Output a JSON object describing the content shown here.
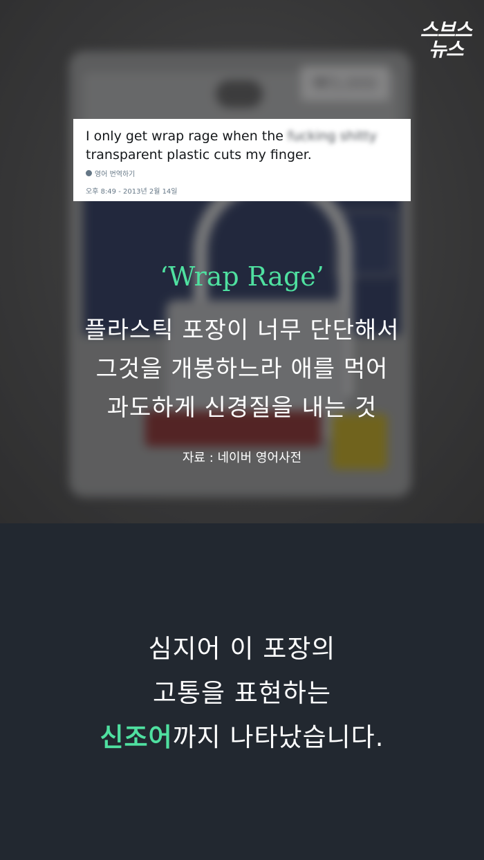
{
  "brand": {
    "logo_line1": "스브스",
    "logo_line2": "뉴스"
  },
  "photo": {
    "price_tag": "₩3,000"
  },
  "tweet": {
    "text_visible": "I only get wrap rage when the",
    "text_blurred": "fucking shitty",
    "text_line2": "transparent plastic cuts my finger.",
    "translate_label": "영어 번역하기",
    "timestamp": "오후 8:49 - 2013년 2월 14일"
  },
  "headline": "‘Wrap Rage’",
  "description": {
    "line1": "플라스틱 포장이 너무 단단해서",
    "line2": "그것을 개봉하느라 애를 먹어",
    "line3": "과도하게 신경질을 내는 것"
  },
  "source": "자료 : 네이버 영어사전",
  "message": {
    "line1": "심지어 이 포장의",
    "line2": "고통을 표현하는",
    "line3_highlight": "신조어",
    "line3_rest": "까지 나타났습니다."
  },
  "colors": {
    "accent": "#4fe0a0",
    "bottom_background": "#222830",
    "text": "#ffffff"
  }
}
